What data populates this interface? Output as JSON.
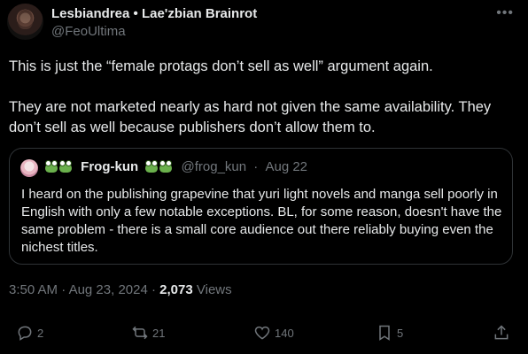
{
  "author": {
    "name": "Lesbiandrea • Lae'zbian Brainrot",
    "handle": "@FeoUltima"
  },
  "menu_icon": "more-dots",
  "post": {
    "paragraph1": "This is just the “female protags don’t sell as well” argument again.",
    "paragraph2": "They are not marketed nearly as hard not given the same availability. They don’t sell as well because publishers don’t allow them to."
  },
  "quote": {
    "name": "Frog-kun",
    "handle": "@frog_kun",
    "date": "Aug 22",
    "meta_sep": "·",
    "text": "I heard on the publishing grapevine that yuri light novels and manga sell poorly in English with only a few notable exceptions. BL, for some reason, doesn't have the same problem - there is a small core audience out there reliably buying even the nichest titles."
  },
  "timestamp": {
    "time": "3:50 AM",
    "date": "Aug 23, 2024",
    "views_count": "2,073",
    "views_label": "Views",
    "sep": "·"
  },
  "actions": {
    "replies": "2",
    "reposts": "21",
    "likes": "140",
    "bookmarks": "5"
  },
  "colors": {
    "background": "#000000",
    "text": "#e7e9ea",
    "muted": "#71767b",
    "border": "#2f3336"
  }
}
